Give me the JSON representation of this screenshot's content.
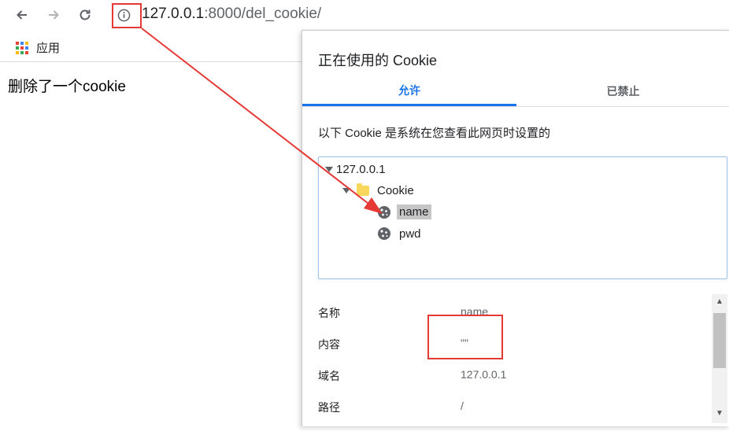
{
  "browser": {
    "url_host": "127.0.0.1",
    "url_rest": ":8000/del_cookie/",
    "back_icon": "arrow-left-icon",
    "forward_icon": "arrow-right-icon",
    "reload_icon": "reload-icon",
    "info_icon": "info-icon"
  },
  "bookmarks": {
    "apps_label": "应用",
    "apps_icon": "apps-grid-icon"
  },
  "page": {
    "message": "删除了一个cookie"
  },
  "popup": {
    "title": "正在使用的 Cookie",
    "tabs": [
      {
        "label": "允许",
        "active": true
      },
      {
        "label": "已禁止",
        "active": false
      }
    ],
    "description": "以下 Cookie 是系统在您查看此网页时设置的",
    "tree": {
      "site": "127.0.0.1",
      "folder": "Cookie",
      "cookies": [
        "name",
        "pwd"
      ],
      "selected": "name"
    },
    "details": [
      {
        "label": "名称",
        "value": "name"
      },
      {
        "label": "内容",
        "value": "\"\""
      },
      {
        "label": "域名",
        "value": "127.0.0.1"
      },
      {
        "label": "路径",
        "value": "/"
      }
    ]
  },
  "colors": {
    "accent": "#1a73e8",
    "annotation": "#e53935"
  }
}
